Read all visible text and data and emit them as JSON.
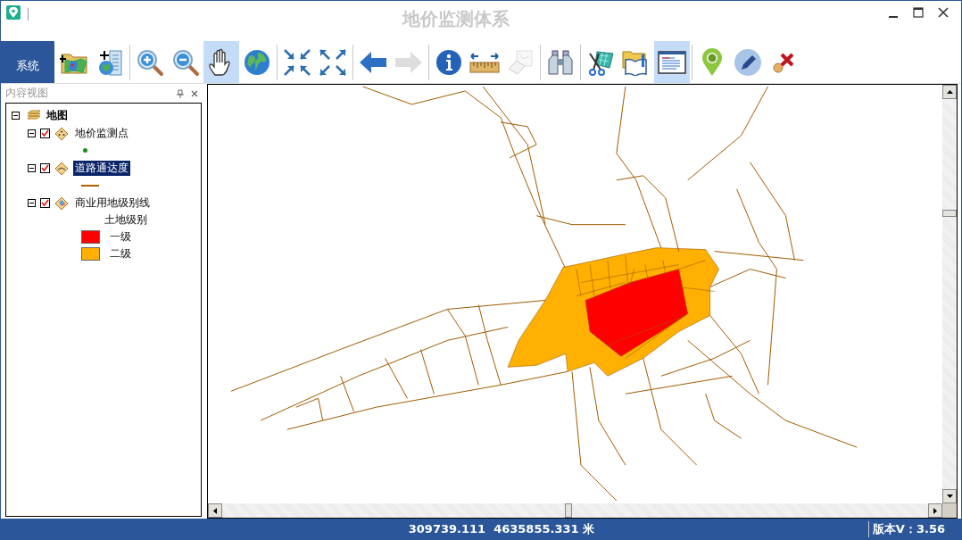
{
  "window": {
    "title": "地价监测体系"
  },
  "toolbar": {
    "menu_button": "系统",
    "groups": [
      [
        {
          "kind": "add-data",
          "active": false,
          "disabled": false
        },
        {
          "kind": "add-service",
          "active": false,
          "disabled": false
        }
      ],
      [
        {
          "kind": "zoom-in",
          "active": false,
          "disabled": false
        },
        {
          "kind": "zoom-out",
          "active": false,
          "disabled": false
        },
        {
          "kind": "pan",
          "active": true,
          "disabled": false
        },
        {
          "kind": "globe",
          "active": false,
          "disabled": false
        }
      ],
      [
        {
          "kind": "shrink",
          "active": false,
          "disabled": false
        },
        {
          "kind": "expand",
          "active": false,
          "disabled": false
        }
      ],
      [
        {
          "kind": "back",
          "active": false,
          "disabled": false
        },
        {
          "kind": "forward",
          "active": false,
          "disabled": true
        }
      ],
      [
        {
          "kind": "info",
          "active": false,
          "disabled": false
        },
        {
          "kind": "measure",
          "active": false,
          "disabled": false
        },
        {
          "kind": "eraser",
          "active": false,
          "disabled": true
        }
      ],
      [
        {
          "kind": "binoculars",
          "active": false,
          "disabled": false
        }
      ],
      [
        {
          "kind": "clip",
          "active": false,
          "disabled": false
        },
        {
          "kind": "catalog",
          "active": false,
          "disabled": false
        },
        {
          "kind": "window",
          "active": true,
          "disabled": false
        }
      ],
      [
        {
          "kind": "pin",
          "active": false,
          "disabled": false
        },
        {
          "kind": "pencil",
          "active": false,
          "disabled": false
        },
        {
          "kind": "delete",
          "active": false,
          "disabled": false
        }
      ]
    ]
  },
  "contents_panel": {
    "title": "内容视图",
    "root": {
      "label": "地图",
      "expanded": true,
      "children": [
        {
          "label": "地价监测点",
          "kind": "point-layer",
          "checked": true,
          "selected": false,
          "expanded": true,
          "legend": [
            {
              "kind": "point",
              "color": "#1a8a1a"
            }
          ]
        },
        {
          "label": "道路通达度",
          "kind": "line-layer",
          "checked": true,
          "selected": true,
          "expanded": true,
          "legend": [
            {
              "kind": "line",
              "color": "#b06000"
            }
          ]
        },
        {
          "label": "商业用地级别线",
          "kind": "polygon-layer",
          "checked": true,
          "selected": false,
          "expanded": true,
          "legend": [
            {
              "kind": "heading",
              "label": "土地级别"
            },
            {
              "kind": "swatch",
              "label": "一级",
              "color": "#ff0000"
            },
            {
              "kind": "swatch",
              "label": "二级",
              "color": "#ffb000"
            }
          ]
        }
      ]
    }
  },
  "status_bar": {
    "coordinates": "309739.111  4635855.331 米",
    "version": "版本V：3.56"
  }
}
